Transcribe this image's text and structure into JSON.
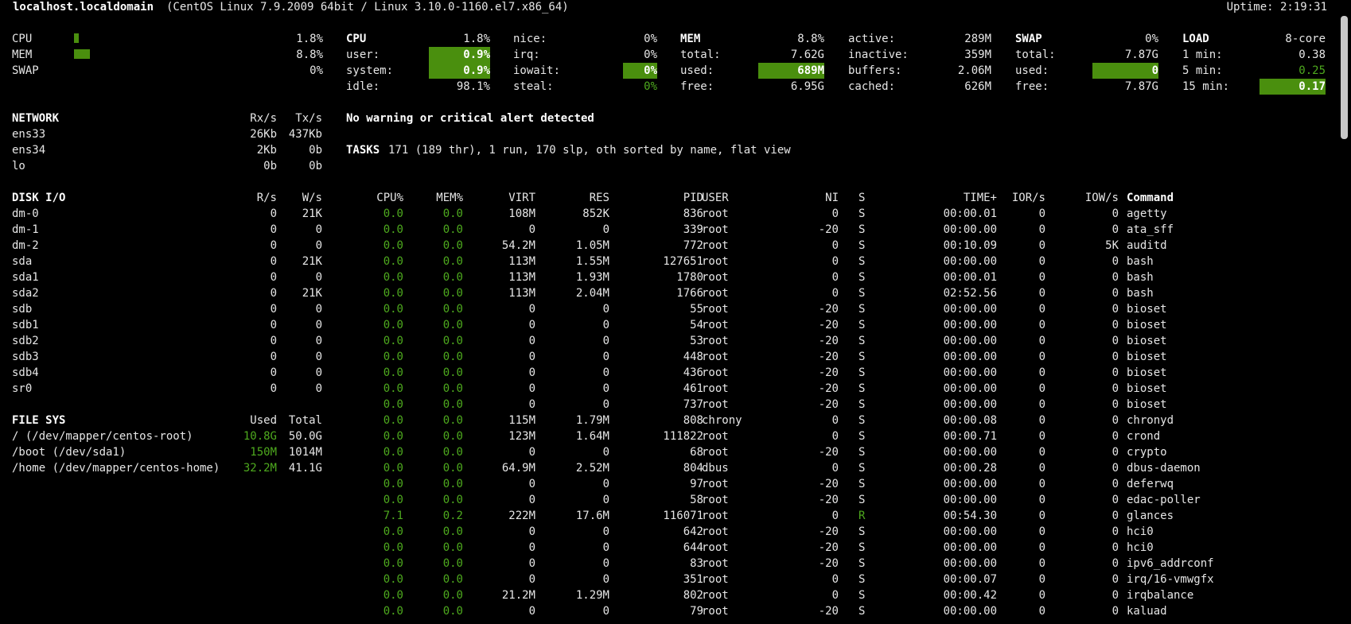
{
  "header": {
    "hostname": "localhost.localdomain",
    "os": "(CentOS Linux 7.9.2009 64bit / Linux 3.10.0-1160.el7.x86_64)",
    "uptime": "Uptime: 2:19:31"
  },
  "quicklook": {
    "cpu_label": "CPU",
    "cpu_value": "1.8%",
    "cpu_fraction": 0.018,
    "mem_label": "MEM",
    "mem_value": "8.8%",
    "mem_fraction": 0.088,
    "swap_label": "SWAP",
    "swap_value": "0%",
    "swap_fraction": 0.0
  },
  "cpu": {
    "title": "CPU",
    "total": "1.8%",
    "user_label": "user:",
    "user": "0.9%",
    "system_label": "system:",
    "system": "0.9%",
    "idle_label": "idle:",
    "idle": "98.1%",
    "nice_label": "nice:",
    "nice": "0%",
    "irq_label": "irq:",
    "irq": "0%",
    "iowait_label": "iowait:",
    "iowait": "0%",
    "steal_label": "steal:",
    "steal": "0%"
  },
  "mem": {
    "title": "MEM",
    "percent": "8.8%",
    "total_label": "total:",
    "total": "7.62G",
    "used_label": "used:",
    "used": "689M",
    "free_label": "free:",
    "free": "6.95G",
    "active_label": "active:",
    "active": "289M",
    "inactive_label": "inactive:",
    "inactive": "359M",
    "buffers_label": "buffers:",
    "buffers": "2.06M",
    "cached_label": "cached:",
    "cached": "626M"
  },
  "swap": {
    "title": "SWAP",
    "percent": "0%",
    "total_label": "total:",
    "total": "7.87G",
    "used_label": "used:",
    "used": "0",
    "free_label": "free:",
    "free": "7.87G"
  },
  "load": {
    "title": "LOAD",
    "cores": "8-core",
    "min1_label": "1 min:",
    "min1": "0.38",
    "min5_label": "5 min:",
    "min5": "0.25",
    "min15_label": "15 min:",
    "min15": "0.17"
  },
  "network": {
    "title": "NETWORK",
    "rx_header": "Rx/s",
    "tx_header": "Tx/s",
    "rows": [
      {
        "name": "ens33",
        "rx": "26Kb",
        "tx": "437Kb"
      },
      {
        "name": "ens34",
        "rx": "2Kb",
        "tx": "0b"
      },
      {
        "name": "lo",
        "rx": "0b",
        "tx": "0b"
      }
    ]
  },
  "diskio": {
    "title": "DISK I/O",
    "r_header": "R/s",
    "w_header": "W/s",
    "rows": [
      {
        "name": "dm-0",
        "r": "0",
        "w": "21K"
      },
      {
        "name": "dm-1",
        "r": "0",
        "w": "0"
      },
      {
        "name": "dm-2",
        "r": "0",
        "w": "0"
      },
      {
        "name": "sda",
        "r": "0",
        "w": "21K"
      },
      {
        "name": "sda1",
        "r": "0",
        "w": "0"
      },
      {
        "name": "sda2",
        "r": "0",
        "w": "21K"
      },
      {
        "name": "sdb",
        "r": "0",
        "w": "0"
      },
      {
        "name": "sdb1",
        "r": "0",
        "w": "0"
      },
      {
        "name": "sdb2",
        "r": "0",
        "w": "0"
      },
      {
        "name": "sdb3",
        "r": "0",
        "w": "0"
      },
      {
        "name": "sdb4",
        "r": "0",
        "w": "0"
      },
      {
        "name": "sr0",
        "r": "0",
        "w": "0"
      }
    ]
  },
  "filesys": {
    "title": "FILE SYS",
    "used_header": "Used",
    "total_header": "Total",
    "rows": [
      {
        "name": "/ (/dev/mapper/centos-root)",
        "used": "10.8G",
        "total": "50.0G"
      },
      {
        "name": "/boot (/dev/sda1)",
        "used": "150M",
        "total": "1014M"
      },
      {
        "name": "/home (/dev/mapper/centos-home)",
        "used": "32.2M",
        "total": "41.1G"
      }
    ]
  },
  "alert": "No warning or critical alert detected",
  "tasks": {
    "label": "TASKS",
    "summary": "171 (189 thr), 1 run, 170 slp, oth sorted by name, flat view"
  },
  "processes": {
    "headers": {
      "cpu": "CPU%",
      "mem": "MEM%",
      "virt": "VIRT",
      "res": "RES",
      "pid": "PID",
      "user": "USER",
      "ni": "NI",
      "s": "S",
      "time": "TIME+",
      "ior": "IOR/s",
      "iow": "IOW/s",
      "cmd": "Command"
    },
    "rows": [
      {
        "cpu": "0.0",
        "mem": "0.0",
        "virt": "108M",
        "res": "852K",
        "pid": "836",
        "user": "root",
        "ni": "0",
        "s": "S",
        "time": "00:00.01",
        "ior": "0",
        "iow": "0",
        "cmd": "agetty"
      },
      {
        "cpu": "0.0",
        "mem": "0.0",
        "virt": "0",
        "res": "0",
        "pid": "339",
        "user": "root",
        "ni": "-20",
        "s": "S",
        "time": "00:00.00",
        "ior": "0",
        "iow": "0",
        "cmd": "ata_sff"
      },
      {
        "cpu": "0.0",
        "mem": "0.0",
        "virt": "54.2M",
        "res": "1.05M",
        "pid": "772",
        "user": "root",
        "ni": "0",
        "s": "S",
        "time": "00:10.09",
        "ior": "0",
        "iow": "5K",
        "cmd": "auditd"
      },
      {
        "cpu": "0.0",
        "mem": "0.0",
        "virt": "113M",
        "res": "1.55M",
        "pid": "127651",
        "user": "root",
        "ni": "0",
        "s": "S",
        "time": "00:00.00",
        "ior": "0",
        "iow": "0",
        "cmd": "bash"
      },
      {
        "cpu": "0.0",
        "mem": "0.0",
        "virt": "113M",
        "res": "1.93M",
        "pid": "1780",
        "user": "root",
        "ni": "0",
        "s": "S",
        "time": "00:00.01",
        "ior": "0",
        "iow": "0",
        "cmd": "bash"
      },
      {
        "cpu": "0.0",
        "mem": "0.0",
        "virt": "113M",
        "res": "2.04M",
        "pid": "1766",
        "user": "root",
        "ni": "0",
        "s": "S",
        "time": "02:52.56",
        "ior": "0",
        "iow": "0",
        "cmd": "bash"
      },
      {
        "cpu": "0.0",
        "mem": "0.0",
        "virt": "0",
        "res": "0",
        "pid": "55",
        "user": "root",
        "ni": "-20",
        "s": "S",
        "time": "00:00.00",
        "ior": "0",
        "iow": "0",
        "cmd": "bioset"
      },
      {
        "cpu": "0.0",
        "mem": "0.0",
        "virt": "0",
        "res": "0",
        "pid": "54",
        "user": "root",
        "ni": "-20",
        "s": "S",
        "time": "00:00.00",
        "ior": "0",
        "iow": "0",
        "cmd": "bioset"
      },
      {
        "cpu": "0.0",
        "mem": "0.0",
        "virt": "0",
        "res": "0",
        "pid": "53",
        "user": "root",
        "ni": "-20",
        "s": "S",
        "time": "00:00.00",
        "ior": "0",
        "iow": "0",
        "cmd": "bioset"
      },
      {
        "cpu": "0.0",
        "mem": "0.0",
        "virt": "0",
        "res": "0",
        "pid": "448",
        "user": "root",
        "ni": "-20",
        "s": "S",
        "time": "00:00.00",
        "ior": "0",
        "iow": "0",
        "cmd": "bioset"
      },
      {
        "cpu": "0.0",
        "mem": "0.0",
        "virt": "0",
        "res": "0",
        "pid": "436",
        "user": "root",
        "ni": "-20",
        "s": "S",
        "time": "00:00.00",
        "ior": "0",
        "iow": "0",
        "cmd": "bioset"
      },
      {
        "cpu": "0.0",
        "mem": "0.0",
        "virt": "0",
        "res": "0",
        "pid": "461",
        "user": "root",
        "ni": "-20",
        "s": "S",
        "time": "00:00.00",
        "ior": "0",
        "iow": "0",
        "cmd": "bioset"
      },
      {
        "cpu": "0.0",
        "mem": "0.0",
        "virt": "0",
        "res": "0",
        "pid": "737",
        "user": "root",
        "ni": "-20",
        "s": "S",
        "time": "00:00.00",
        "ior": "0",
        "iow": "0",
        "cmd": "bioset"
      },
      {
        "cpu": "0.0",
        "mem": "0.0",
        "virt": "115M",
        "res": "1.79M",
        "pid": "808",
        "user": "chrony",
        "ni": "0",
        "s": "S",
        "time": "00:00.08",
        "ior": "0",
        "iow": "0",
        "cmd": "chronyd"
      },
      {
        "cpu": "0.0",
        "mem": "0.0",
        "virt": "123M",
        "res": "1.64M",
        "pid": "111822",
        "user": "root",
        "ni": "0",
        "s": "S",
        "time": "00:00.71",
        "ior": "0",
        "iow": "0",
        "cmd": "crond"
      },
      {
        "cpu": "0.0",
        "mem": "0.0",
        "virt": "0",
        "res": "0",
        "pid": "68",
        "user": "root",
        "ni": "-20",
        "s": "S",
        "time": "00:00.00",
        "ior": "0",
        "iow": "0",
        "cmd": "crypto"
      },
      {
        "cpu": "0.0",
        "mem": "0.0",
        "virt": "64.9M",
        "res": "2.52M",
        "pid": "804",
        "user": "dbus",
        "ni": "0",
        "s": "S",
        "time": "00:00.28",
        "ior": "0",
        "iow": "0",
        "cmd": "dbus-daemon"
      },
      {
        "cpu": "0.0",
        "mem": "0.0",
        "virt": "0",
        "res": "0",
        "pid": "97",
        "user": "root",
        "ni": "-20",
        "s": "S",
        "time": "00:00.00",
        "ior": "0",
        "iow": "0",
        "cmd": "deferwq"
      },
      {
        "cpu": "0.0",
        "mem": "0.0",
        "virt": "0",
        "res": "0",
        "pid": "58",
        "user": "root",
        "ni": "-20",
        "s": "S",
        "time": "00:00.00",
        "ior": "0",
        "iow": "0",
        "cmd": "edac-poller"
      },
      {
        "cpu": "7.1",
        "mem": "0.2",
        "virt": "222M",
        "res": "17.6M",
        "pid": "116071",
        "user": "root",
        "ni": "0",
        "s": "R",
        "time": "00:54.30",
        "ior": "0",
        "iow": "0",
        "cmd": "glances"
      },
      {
        "cpu": "0.0",
        "mem": "0.0",
        "virt": "0",
        "res": "0",
        "pid": "642",
        "user": "root",
        "ni": "-20",
        "s": "S",
        "time": "00:00.00",
        "ior": "0",
        "iow": "0",
        "cmd": "hci0"
      },
      {
        "cpu": "0.0",
        "mem": "0.0",
        "virt": "0",
        "res": "0",
        "pid": "644",
        "user": "root",
        "ni": "-20",
        "s": "S",
        "time": "00:00.00",
        "ior": "0",
        "iow": "0",
        "cmd": "hci0"
      },
      {
        "cpu": "0.0",
        "mem": "0.0",
        "virt": "0",
        "res": "0",
        "pid": "83",
        "user": "root",
        "ni": "-20",
        "s": "S",
        "time": "00:00.00",
        "ior": "0",
        "iow": "0",
        "cmd": "ipv6_addrconf"
      },
      {
        "cpu": "0.0",
        "mem": "0.0",
        "virt": "0",
        "res": "0",
        "pid": "351",
        "user": "root",
        "ni": "0",
        "s": "S",
        "time": "00:00.07",
        "ior": "0",
        "iow": "0",
        "cmd": "irq/16-vmwgfx"
      },
      {
        "cpu": "0.0",
        "mem": "0.0",
        "virt": "21.2M",
        "res": "1.29M",
        "pid": "802",
        "user": "root",
        "ni": "0",
        "s": "S",
        "time": "00:00.42",
        "ior": "0",
        "iow": "0",
        "cmd": "irqbalance"
      },
      {
        "cpu": "0.0",
        "mem": "0.0",
        "virt": "0",
        "res": "0",
        "pid": "79",
        "user": "root",
        "ni": "-20",
        "s": "S",
        "time": "00:00.00",
        "ior": "0",
        "iow": "0",
        "cmd": "kaluad"
      }
    ]
  },
  "colors": {
    "background": "#000000",
    "accent_green": "#4eaa1e",
    "highlight": "#4a8f0e"
  }
}
